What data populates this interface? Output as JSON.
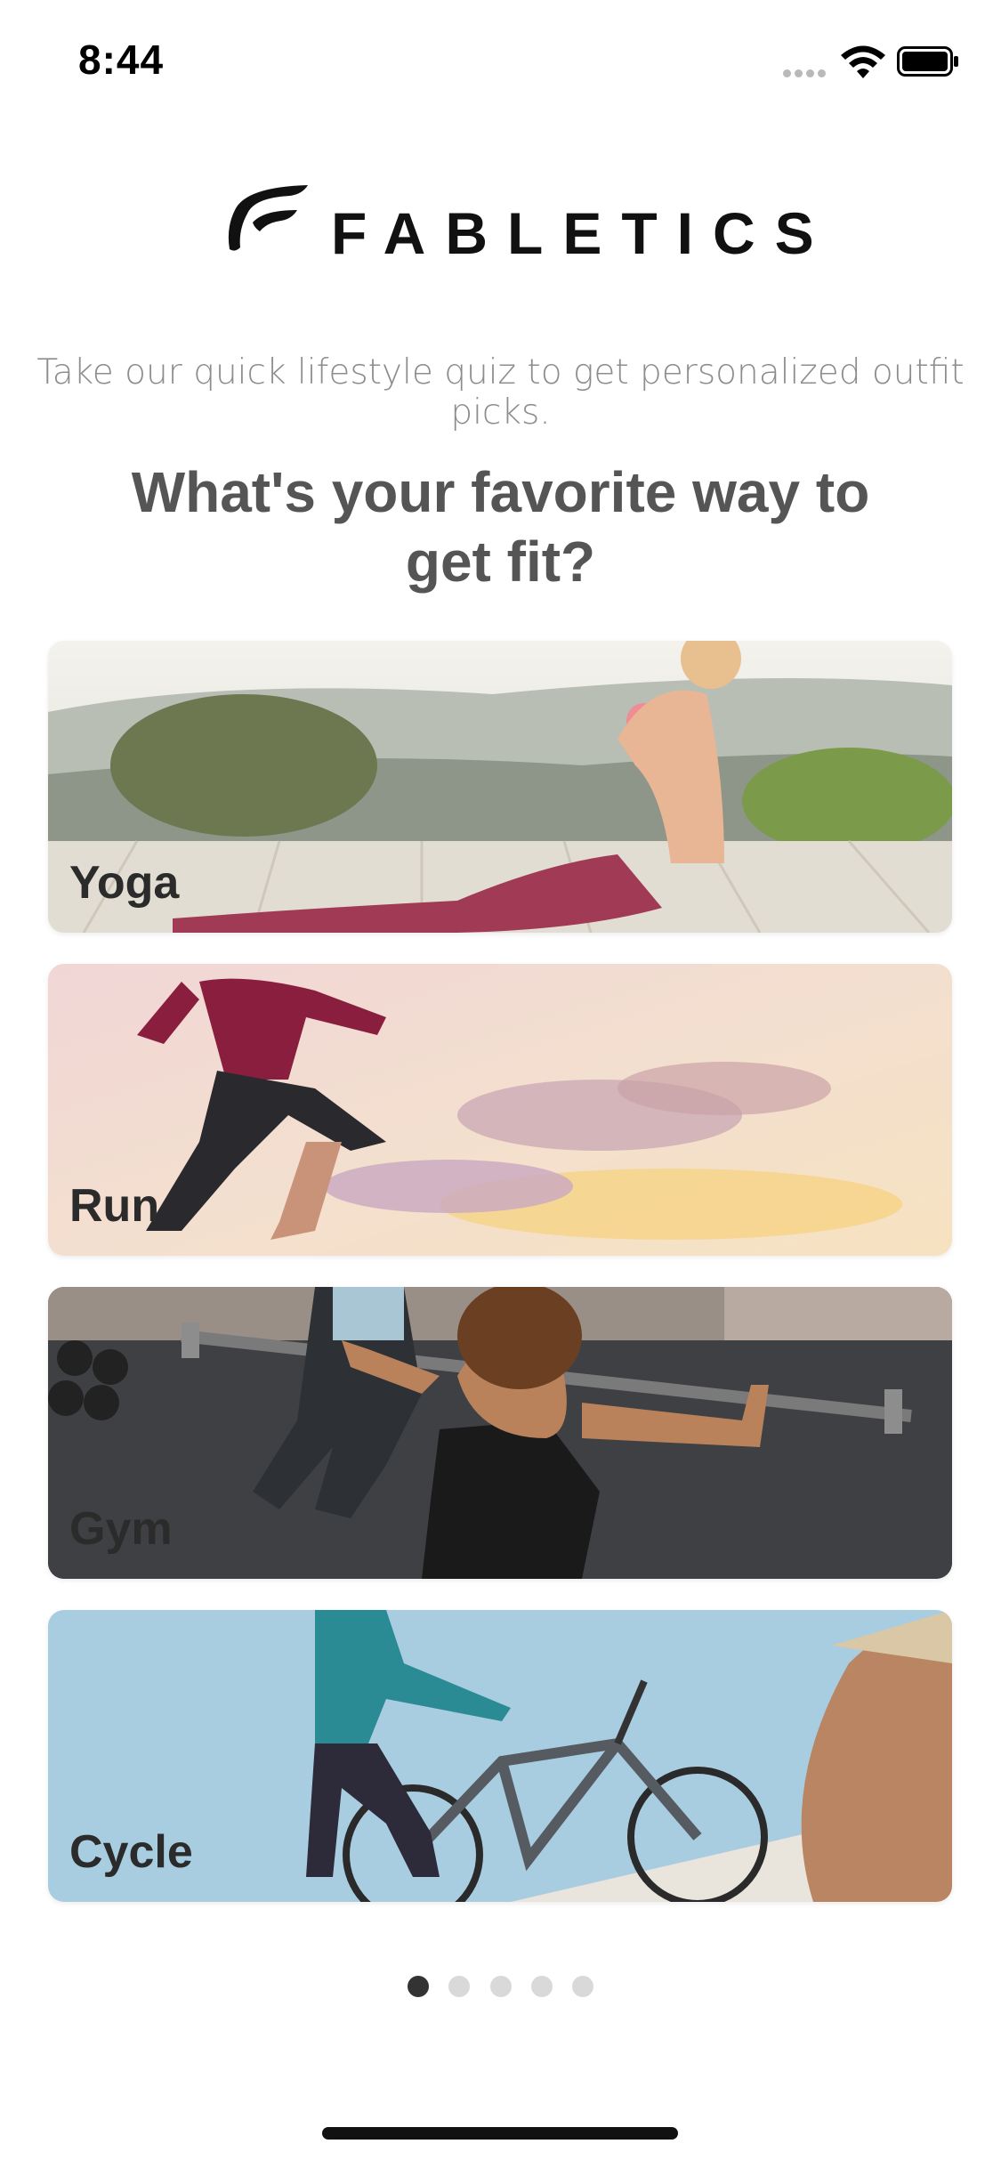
{
  "status_bar": {
    "time": "8:44",
    "icons": [
      "signal-dots-icon",
      "wifi-icon",
      "battery-icon"
    ]
  },
  "brand": {
    "name": "FABLETICS",
    "logo_icon": "fabletics-f-mark-icon"
  },
  "subtitle": "Take our quick lifestyle quiz to get personalized outfit picks.",
  "question": "What's your favorite way to get fit?",
  "options": [
    {
      "label": "Yoga"
    },
    {
      "label": "Run"
    },
    {
      "label": "Gym"
    },
    {
      "label": "Cycle"
    }
  ],
  "pagination": {
    "total": 5,
    "current": 1
  },
  "colors": {
    "accent": "#333333",
    "question_text": "#555555",
    "subtitle_text": "#8d8d8d",
    "dot_inactive": "#d9d9d9"
  }
}
